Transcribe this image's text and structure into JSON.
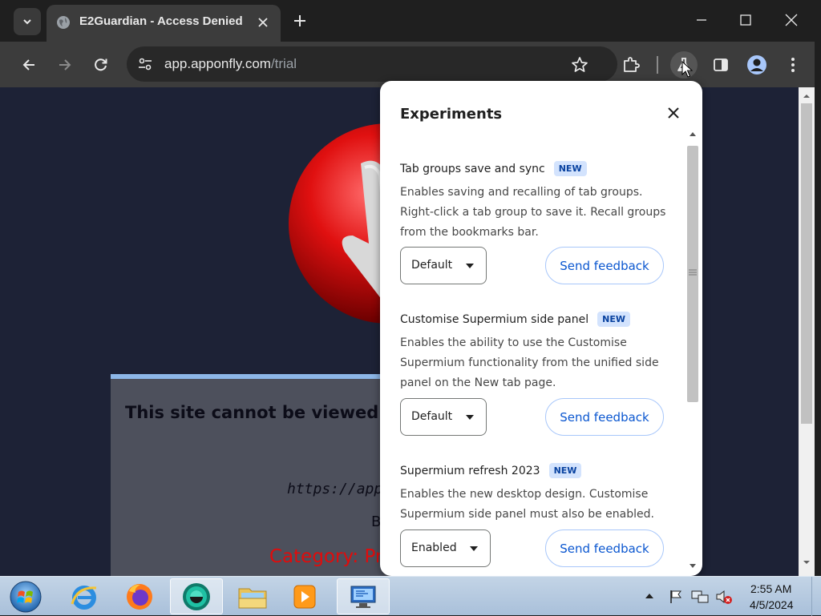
{
  "browser": {
    "tab": {
      "title": "E2Guardian - Access Denied",
      "favicon": "globe-icon"
    },
    "address": {
      "domain": "app.apponfly.com",
      "path": "/trial"
    },
    "colors": {
      "frame": "#1f1f1f",
      "toolbar": "#3c3c3c"
    }
  },
  "page": {
    "title": "This site cannot be viewed at",
    "url": "https://app.",
    "line2": "B",
    "category": "Category: Pr"
  },
  "experiments": {
    "title": "Experiments",
    "features": [
      {
        "name": "Tab groups save and sync",
        "badge": "NEW",
        "description": "Enables saving and recalling of tab groups. Right-click a tab group to save it. Recall groups from the bookmarks bar.",
        "state": "Default",
        "feedback": "Send feedback"
      },
      {
        "name": "Customise Supermium side panel",
        "badge": "NEW",
        "description": "Enables the ability to use the Customise Supermium functionality from the unified side panel on the New tab page.",
        "state": "Default",
        "feedback": "Send feedback"
      },
      {
        "name": "Supermium refresh 2023",
        "badge": "NEW",
        "description": "Enables the new desktop design. Customise Supermium side panel must also be enabled.",
        "state": "Enabled",
        "feedback": "Send feedback"
      }
    ]
  },
  "taskbar": {
    "items": [
      "start-orb",
      "internet-explorer",
      "firefox",
      "supermium",
      "file-explorer",
      "media-player",
      "remote-desktop"
    ],
    "time": "2:55 AM",
    "date": "4/5/2024"
  }
}
